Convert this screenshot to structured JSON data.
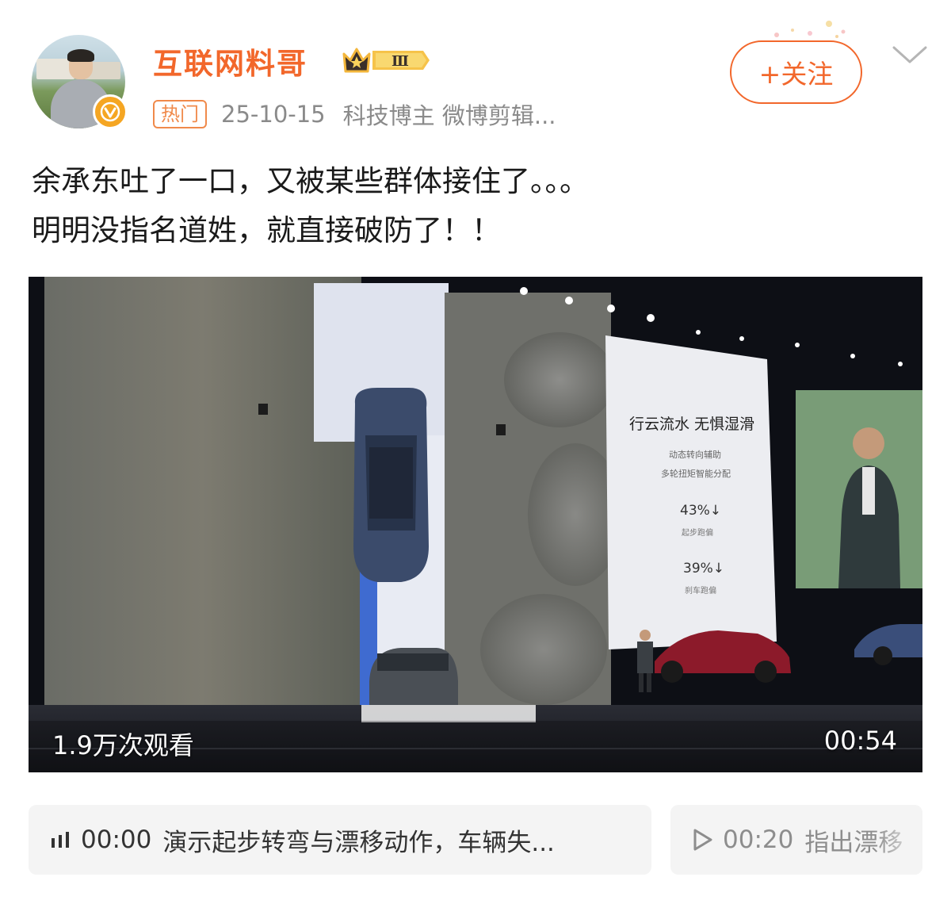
{
  "author": {
    "name": "互联网料哥",
    "rank_badge": "Ⅲ",
    "hot_tag": "热门",
    "date": "25-10-15",
    "source": "科技博主 微博剪辑...",
    "follow_label": "+关注"
  },
  "post": {
    "lines": [
      "余承东吐了一口，又被某些群体接住了。。。",
      "明明没指名道姓，就直接破防了！！"
    ]
  },
  "video": {
    "views": "1.9万次观看",
    "duration": "00:54",
    "slide": {
      "title": "行云流水 无惧湿滑",
      "line1": "动态转向辅助",
      "line2": "多轮扭矩智能分配",
      "stat1_value": "43%↓",
      "stat1_label": "起步跑偏",
      "stat2_value": "39%↓",
      "stat2_label": "刹车跑偏"
    }
  },
  "chapters": [
    {
      "time": "00:00",
      "text": "演示起步转弯与漂移动作，车辆失...",
      "icon": "playing-bars-icon"
    },
    {
      "time": "00:20",
      "text": "指出漂移",
      "icon": "play-icon"
    }
  ],
  "colors": {
    "accent": "#f2672b",
    "gold": "#f5a623"
  }
}
